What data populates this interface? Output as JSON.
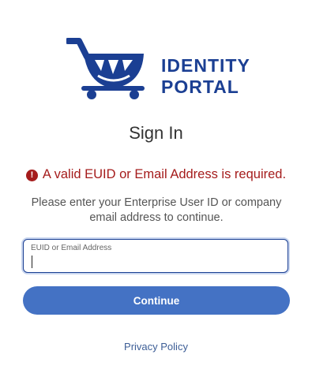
{
  "logo": {
    "line1": "IDENTITY",
    "line2": "PORTAL",
    "icon": "cart-icon",
    "brand_color": "#1b3f93"
  },
  "title": "Sign In",
  "error": {
    "icon": "error-icon",
    "icon_glyph": "!",
    "message": "A valid EUID or Email Address is required.",
    "color": "#a51c1c"
  },
  "instructions": "Please enter your Enterprise User ID or company email address to continue.",
  "euid_field": {
    "label": "EUID or Email Address",
    "value": ""
  },
  "continue_button": {
    "label": "Continue",
    "color": "#4472c4"
  },
  "privacy_link": "Privacy Policy"
}
